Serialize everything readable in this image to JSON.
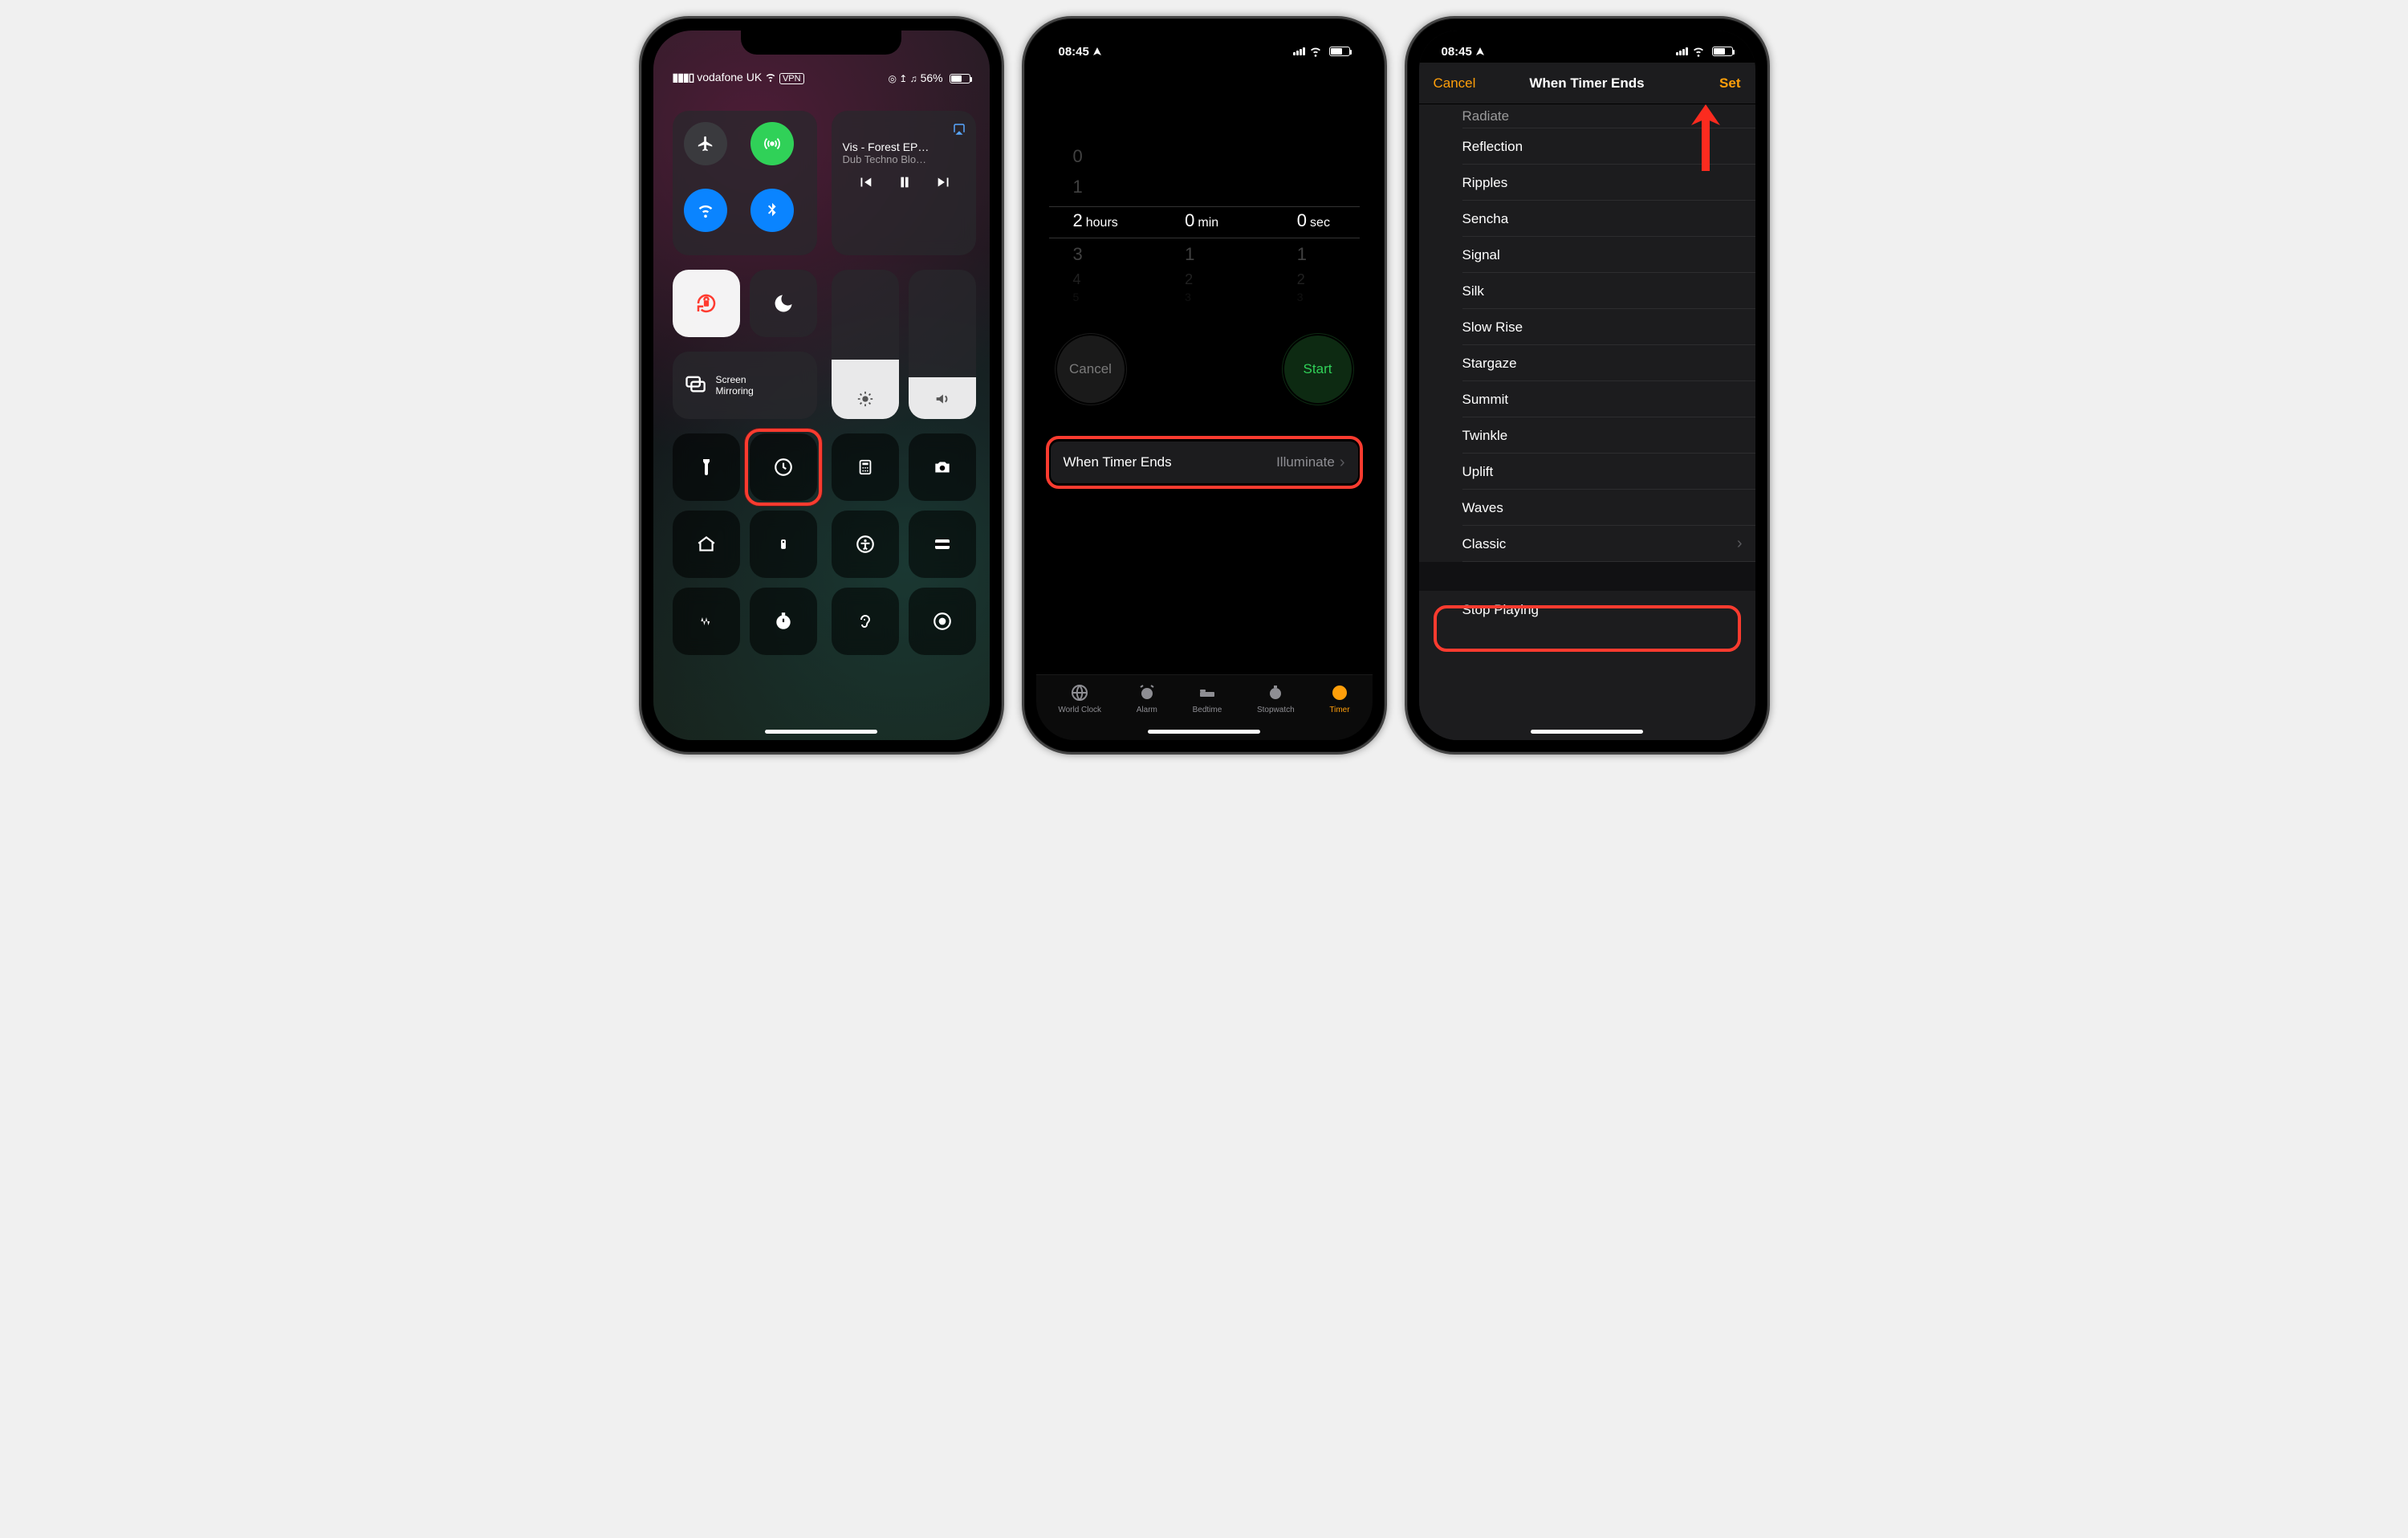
{
  "screen1": {
    "status": {
      "carrier": "vodafone UK",
      "wifi": true,
      "vpn": "VPN",
      "right": "56%",
      "indicators": "⊙ ↥ ♫"
    },
    "media": {
      "title": "Vis - Forest EP…",
      "subtitle": "Dub Techno Blo…",
      "airplay": true
    },
    "screenMirroring": "Screen\nMirroring",
    "brightnessPct": 40,
    "volumePct": 28
  },
  "screen2": {
    "time": "08:45",
    "picker": {
      "hours": {
        "above2": "0",
        "above1": "1",
        "selected": "2",
        "below1": "3",
        "below2": "4",
        "below3": "5",
        "label": "hours"
      },
      "minutes": {
        "above2": "",
        "above1": "",
        "selected": "0",
        "below1": "1",
        "below2": "2",
        "below3": "3",
        "label": "min"
      },
      "seconds": {
        "above2": "",
        "above1": "",
        "selected": "0",
        "below1": "1",
        "below2": "2",
        "below3": "3",
        "label": "sec"
      }
    },
    "cancel": "Cancel",
    "start": "Start",
    "whenTimerEnds": {
      "label": "When Timer Ends",
      "value": "Illuminate"
    },
    "tabs": [
      "World Clock",
      "Alarm",
      "Bedtime",
      "Stopwatch",
      "Timer"
    ],
    "activeTab": "Timer"
  },
  "screen3": {
    "time": "08:45",
    "nav": {
      "cancel": "Cancel",
      "title": "When Timer Ends",
      "set": "Set"
    },
    "options_cut": "Radiate",
    "options": [
      "Reflection",
      "Ripples",
      "Sencha",
      "Signal",
      "Silk",
      "Slow Rise",
      "Stargaze",
      "Summit",
      "Twinkle",
      "Uplift",
      "Waves"
    ],
    "classic": "Classic",
    "stop": "Stop Playing"
  },
  "colors": {
    "highlight": "#fb3b2f",
    "accent": "#ff9f0a",
    "green": "#30d158"
  }
}
